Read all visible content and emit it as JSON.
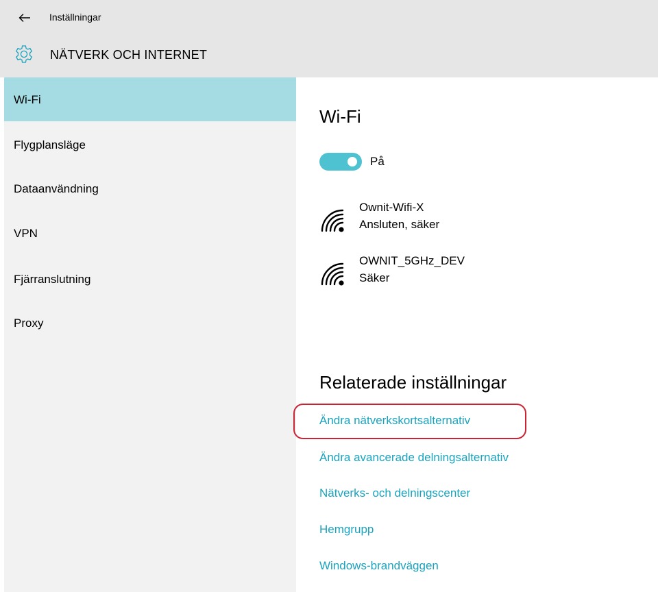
{
  "window": {
    "title": "Inställningar",
    "back_icon": "arrow-left-icon"
  },
  "header": {
    "title": "NÄTVERK OCH INTERNET",
    "icon": "gear-icon"
  },
  "sidebar": {
    "items": [
      {
        "label": "Wi-Fi",
        "active": true
      },
      {
        "label": "Flygplansläge",
        "active": false
      },
      {
        "label": "Dataanvändning",
        "active": false
      },
      {
        "label": "VPN",
        "active": false
      },
      {
        "label": "Fjärranslutning",
        "active": false
      },
      {
        "label": "Proxy",
        "active": false
      }
    ]
  },
  "main": {
    "wifi_title": "Wi-Fi",
    "toggle": {
      "state": "on",
      "label": "På"
    },
    "networks": [
      {
        "name": "Ownit-Wifi-X",
        "status": "Ansluten, säker"
      },
      {
        "name": "OWNIT_5GHz_DEV",
        "status": "Säker"
      }
    ],
    "related_title": "Relaterade inställningar",
    "links": [
      "Ändra nätverkskortsalternativ",
      "Ändra avancerade delningsalternativ",
      "Nätverks- och delningscenter",
      "Hemgrupp",
      "Windows-brandväggen"
    ]
  },
  "colors": {
    "accent": "#4fc2d2",
    "link": "#1aa3bd",
    "selected_nav": "#a5dce4",
    "header_bg": "#e6e6e6",
    "sidebar_bg": "#f2f2f2",
    "highlight": "#cc2233"
  }
}
